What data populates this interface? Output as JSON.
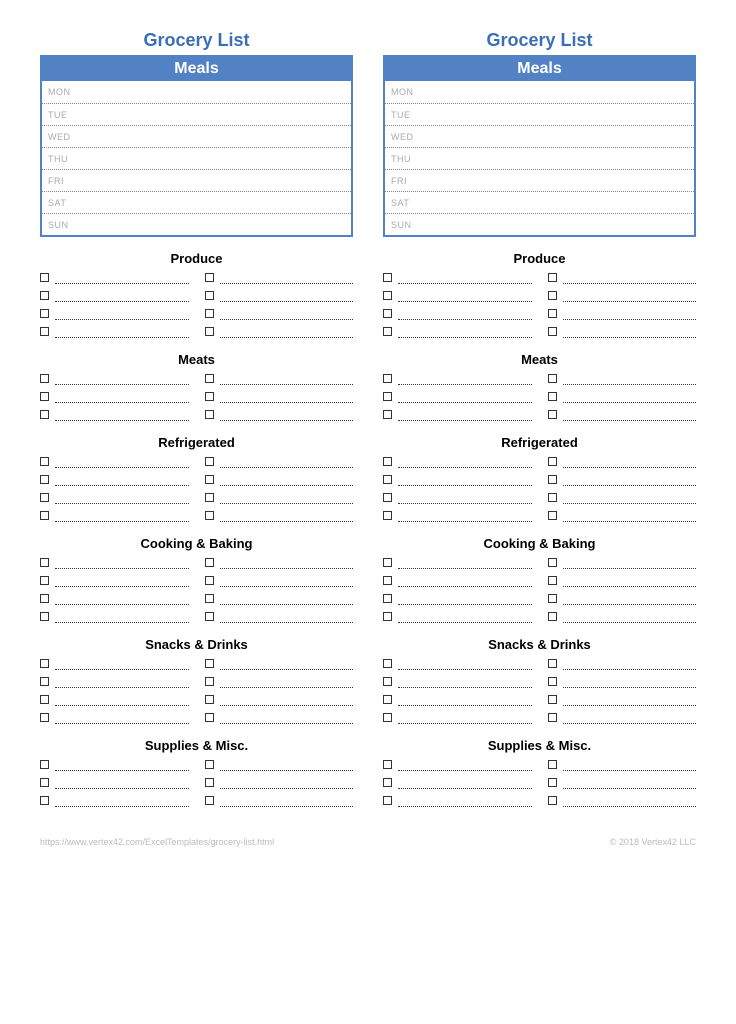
{
  "title": "Grocery List",
  "meals_header": "Meals",
  "days": [
    "MON",
    "TUE",
    "WED",
    "THU",
    "FRI",
    "SAT",
    "SUN"
  ],
  "categories": [
    {
      "name": "Produce",
      "rows": 4
    },
    {
      "name": "Meats",
      "rows": 3
    },
    {
      "name": "Refrigerated",
      "rows": 4
    },
    {
      "name": "Cooking & Baking",
      "rows": 4
    },
    {
      "name": "Snacks & Drinks",
      "rows": 4
    },
    {
      "name": "Supplies & Misc.",
      "rows": 3
    }
  ],
  "footer_left": "https://www.vertex42.com/ExcelTemplates/grocery-list.html",
  "footer_right": "© 2018 Vertex42 LLC"
}
